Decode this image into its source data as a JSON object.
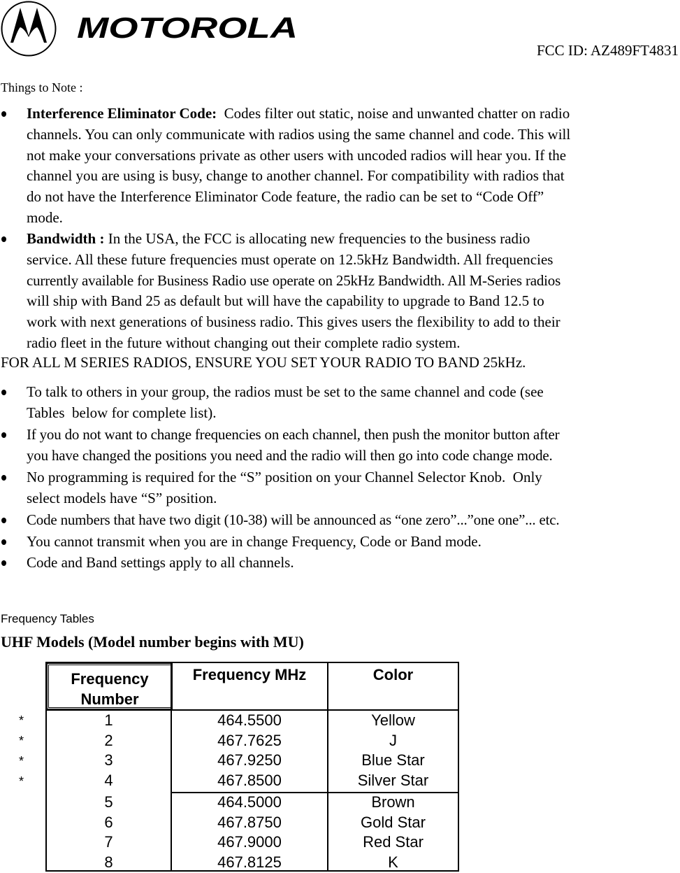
{
  "header": {
    "brand": "MOTOROLA",
    "logo_icon": "motorola-batwing-logo",
    "fcc_id": "FCC ID: AZ489FT4831"
  },
  "intro": {
    "things_to_note": "Things to Note :"
  },
  "bullets_primary": [
    {
      "term": "Interference Eliminator Code:",
      "lines": [
        "  Codes filter out static, noise and unwanted chatter on radio",
        "channels. You can only communicate with radios using the same channel and code. This will",
        "not make your conversations private as other users with uncoded radios will hear you. If the",
        "channel you are using is busy, change to another channel. For compatibility with radios that",
        "do not have the Interference Eliminator Code feature, the radio can be set to “Code Off”",
        "mode."
      ]
    },
    {
      "term": "Bandwidth :",
      "lines": [
        " In the USA, the FCC is allocating new frequencies to the business radio",
        "service.  All these future frequencies must operate on 12.5kHz Bandwidth. All frequencies",
        "currently available for Business Radio use operate on 25kHz Bandwidth.  All M-Series radios",
        "will ship with Band 25 as default but will have the capability to upgrade to Band 12.5  to",
        "work with next generations of business radio.  This gives users the flexibility to add to their",
        "radio fleet in the future without changing out their complete radio system."
      ]
    }
  ],
  "all_caps_notice": "FOR ALL M SERIES RADIOS, ENSURE YOU SET YOUR RADIO TO BAND 25kHz.",
  "bullets_secondary": [
    {
      "lines": [
        "To talk to others in your group, the radios must be set to the same channel and code (see",
        "Tables  below for complete list)."
      ]
    },
    {
      "lines": [
        "If you do not want to change frequencies on each channel, then push the monitor button after",
        "you have changed the positions you need and the radio will then go into code change mode."
      ]
    },
    {
      "lines": [
        "No programming is required for the “S” position on your Channel Selector Knob.  Only",
        "select models have “S” position."
      ]
    },
    {
      "lines": [
        "Code numbers that have two digit (10-38) will be announced as “one zero”...”one one”... etc."
      ]
    },
    {
      "lines": [
        "You cannot transmit when you are in change Frequency, Code or Band mode."
      ]
    },
    {
      "lines": [
        "Code and Band settings apply to all channels."
      ]
    }
  ],
  "frequency_section": {
    "label": "Frequency Tables",
    "title": "UHF Models  (Model number begins with MU)",
    "table": {
      "headers": [
        "Frequency Number",
        "Frequency MHz",
        "Color"
      ],
      "header_lines": [
        [
          "Frequency",
          "Number"
        ],
        [
          "Frequency MHz"
        ],
        [
          "Color"
        ]
      ],
      "rows": [
        {
          "marker": "*",
          "number": "1",
          "mhz": "464.5500",
          "color": "Yellow"
        },
        {
          "marker": "*",
          "number": "2",
          "mhz": "467.7625",
          "color": "J"
        },
        {
          "marker": "*",
          "number": "3",
          "mhz": "467.9250",
          "color": "Blue Star"
        },
        {
          "marker": "*",
          "number": "4",
          "mhz": "467.8500",
          "color": "Silver Star"
        },
        {
          "marker": "",
          "number": "5",
          "mhz": "464.5000",
          "color": "Brown"
        },
        {
          "marker": "",
          "number": "6",
          "mhz": "467.8750",
          "color": "Gold Star"
        },
        {
          "marker": "",
          "number": "7",
          "mhz": "467.9000",
          "color": "Red Star"
        },
        {
          "marker": "",
          "number": "8",
          "mhz": "467.8125",
          "color": "K"
        }
      ]
    }
  }
}
